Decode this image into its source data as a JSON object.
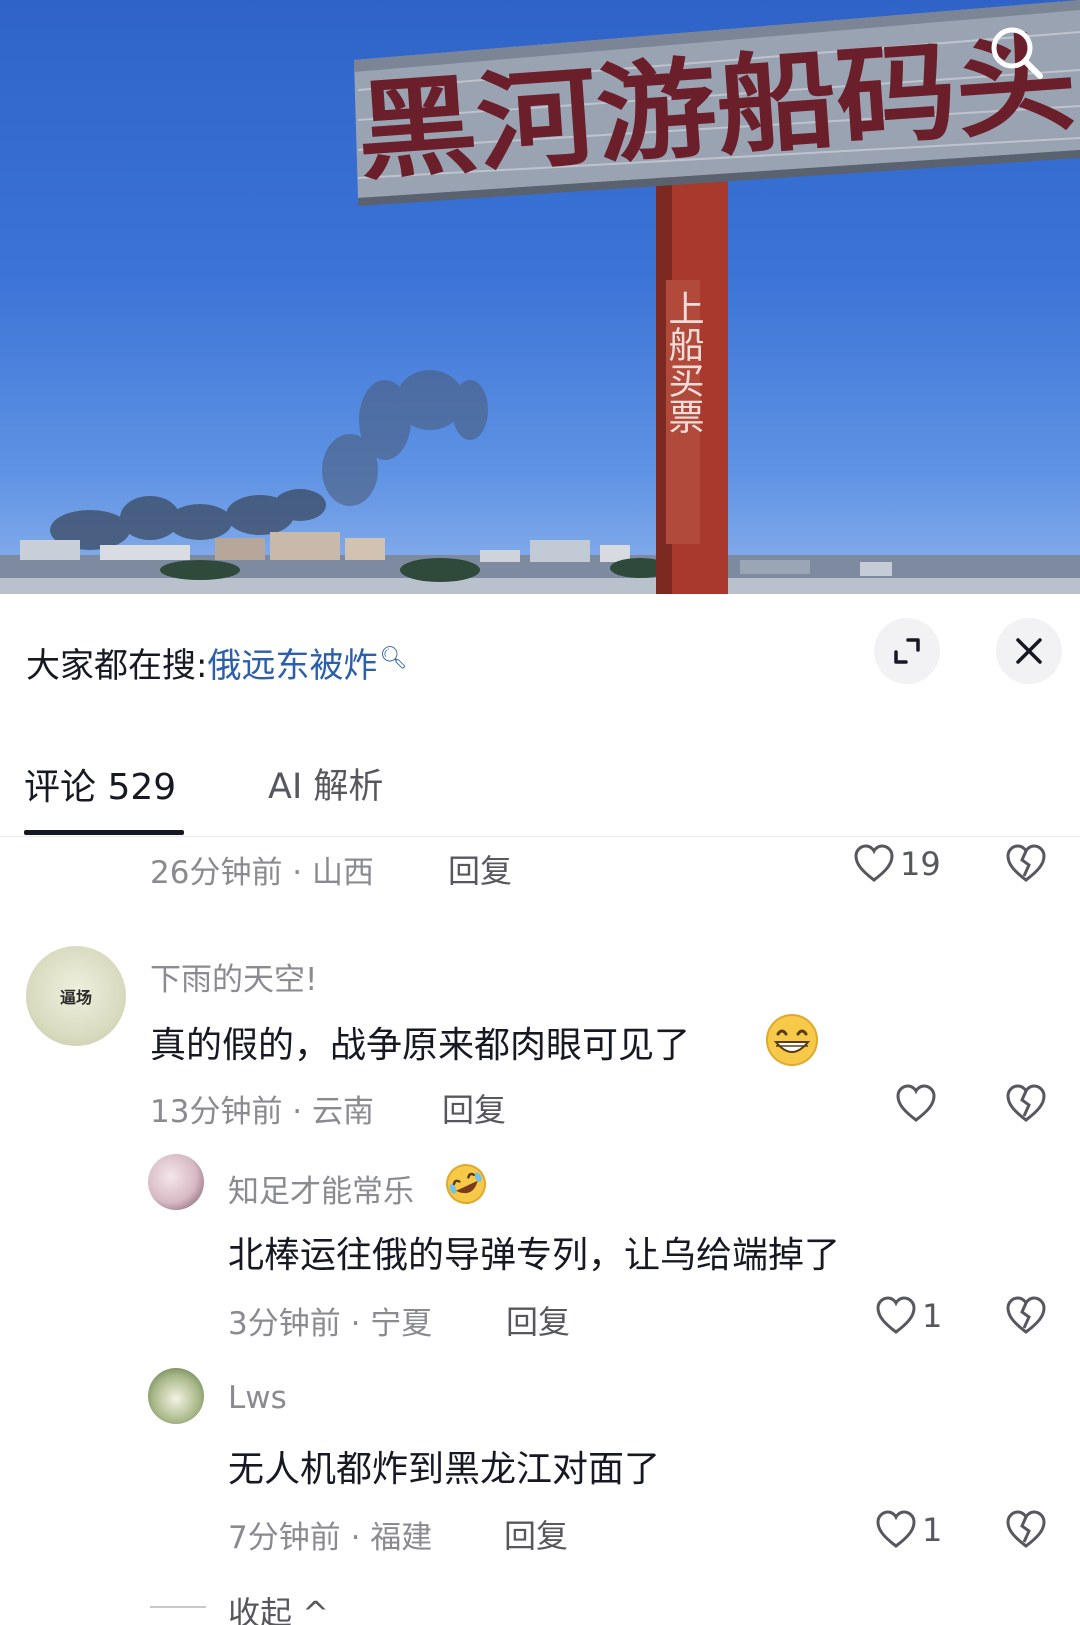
{
  "video": {
    "sign_text": "黑河游船码头",
    "pole_text": "上船买票",
    "search_icon": "search-icon"
  },
  "search_bar": {
    "prefix": "大家都在搜:",
    "keyword": "俄远东被炸",
    "keyword_icon": "mini-search-icon",
    "expand_icon": "expand-icon",
    "close_icon": "close-icon"
  },
  "tabs": {
    "comments": "评论 529",
    "ai": "AI 解析"
  },
  "comments": [
    {
      "time_location": "26分钟前 · 山西",
      "reply_label": "回复",
      "like_count": "19"
    },
    {
      "username": "下雨的天空!",
      "avatar_text": "逼场",
      "text": "真的假的，战争原来都肉眼可见了",
      "emoji": "grin-emoji",
      "time_location": "13分钟前 · 云南",
      "reply_label": "回复",
      "like_count": ""
    },
    {
      "username": "知足才能常乐",
      "emoji": "rofl-emoji",
      "text": "北棒运往俄的导弹专列，让乌给端掉了",
      "time_location": "3分钟前 · 宁夏",
      "reply_label": "回复",
      "like_count": "1"
    },
    {
      "username": "Lws",
      "text": "无人机都炸到黑龙江对面了",
      "time_location": "7分钟前 · 福建",
      "reply_label": "回复",
      "like_count": "1"
    }
  ],
  "collapse_label": "收起 ^"
}
